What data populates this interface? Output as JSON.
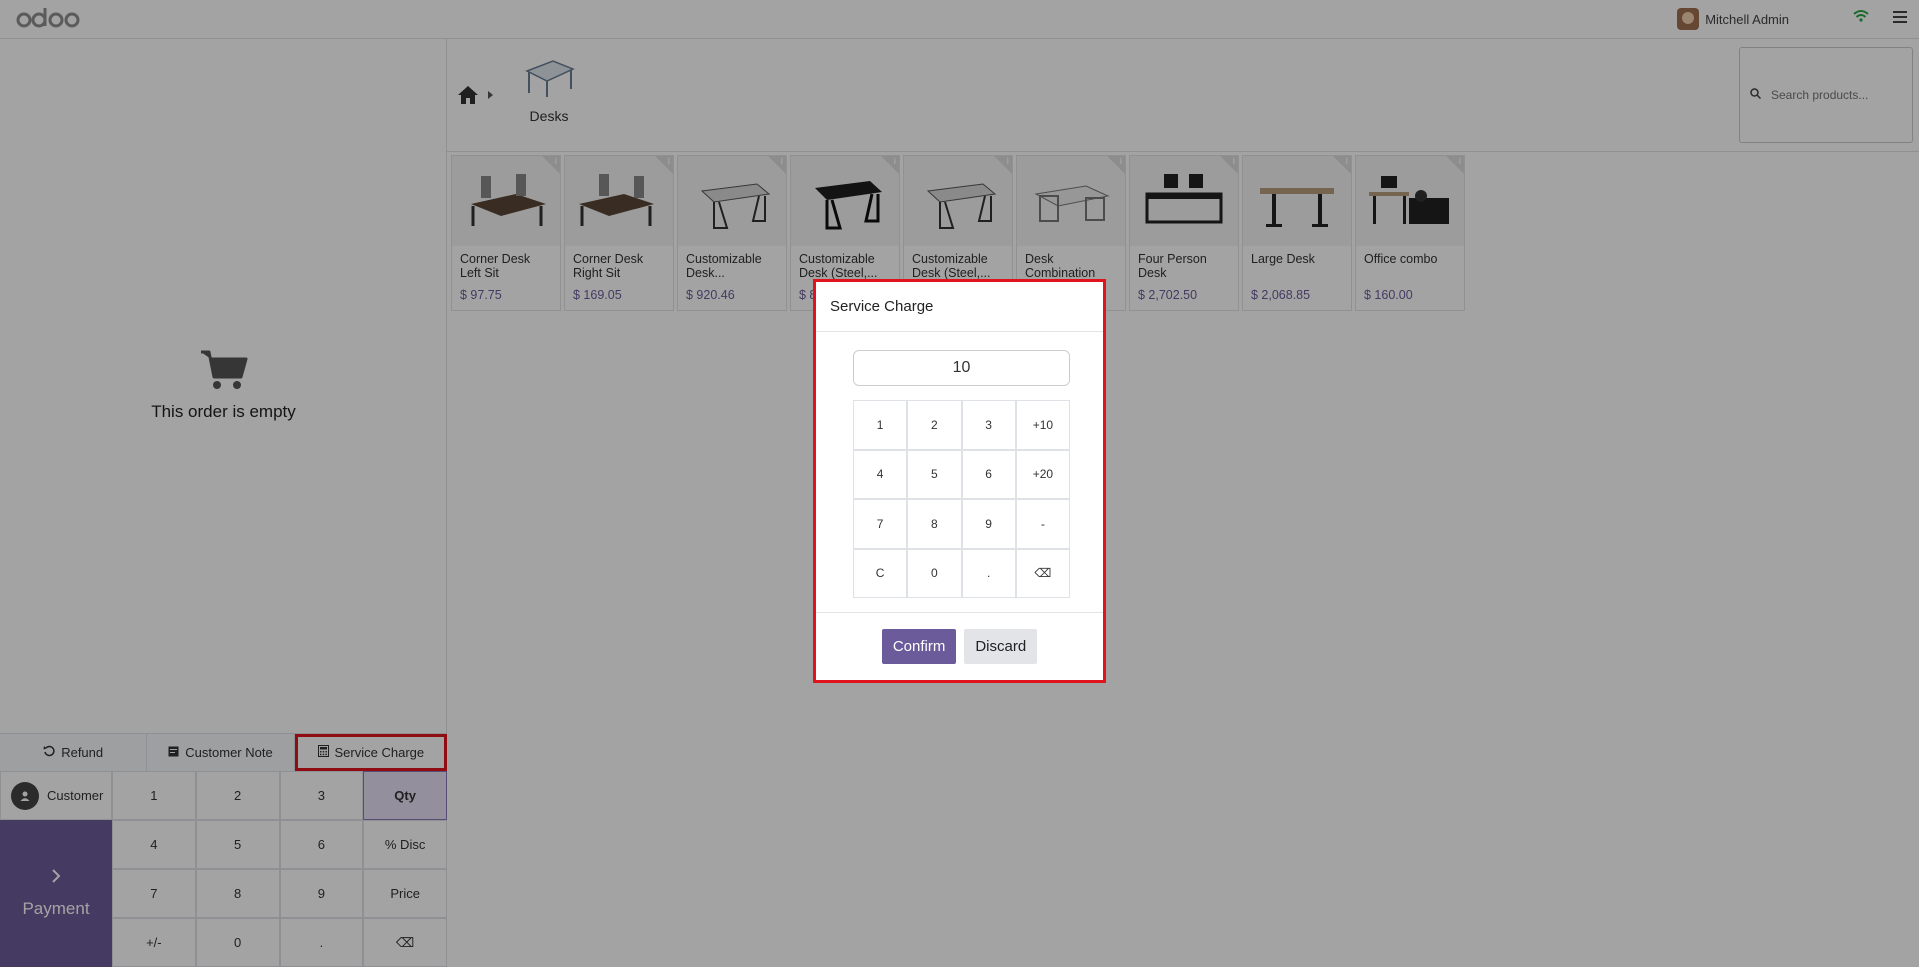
{
  "topbar": {
    "logo_text": "odoo",
    "user_name": "Mitchell Admin",
    "wifi_icon": "wifi-icon",
    "menu_icon": "hamburger-icon"
  },
  "order": {
    "empty_text": "This order is empty",
    "cart_icon": "cart-icon"
  },
  "controls": {
    "refund_label": "Refund",
    "note_label": "Customer Note",
    "service_label": "Service Charge"
  },
  "pad": {
    "customer_label": "Customer",
    "payment_label": "Payment",
    "keys": [
      "1",
      "2",
      "3",
      "Qty",
      "4",
      "5",
      "6",
      "% Disc",
      "7",
      "8",
      "9",
      "Price",
      "+/-",
      "0",
      ".",
      "⌫"
    ],
    "active_mode": "Qty"
  },
  "breadcrumb": {
    "category": "Desks"
  },
  "search": {
    "placeholder": "Search products..."
  },
  "products": [
    {
      "name": "Corner Desk Left Sit",
      "price": "$ 97.75"
    },
    {
      "name": "Corner Desk Right Sit",
      "price": "$ 169.05"
    },
    {
      "name": "Customizable Desk...",
      "price": "$ 920.46"
    },
    {
      "name": "Customizable Desk (Steel,...",
      "price": "$ 8"
    },
    {
      "name": "Customizable Desk (Steel,...",
      "price": ""
    },
    {
      "name": "Desk Combination",
      "price": ""
    },
    {
      "name": "Four Person Desk",
      "price": "$ 2,702.50"
    },
    {
      "name": "Large Desk",
      "price": "$ 2,068.85"
    },
    {
      "name": "Office combo",
      "price": "$ 160.00"
    }
  ],
  "dialog": {
    "title": "Service Charge",
    "value": "10",
    "keys": [
      "1",
      "2",
      "3",
      "+10",
      "4",
      "5",
      "6",
      "+20",
      "7",
      "8",
      "9",
      "-",
      "C",
      "0",
      ".",
      "⌫"
    ],
    "confirm_label": "Confirm",
    "discard_label": "Discard"
  },
  "colors": {
    "accent": "#6b5b9a",
    "highlight": "#e0141e"
  }
}
